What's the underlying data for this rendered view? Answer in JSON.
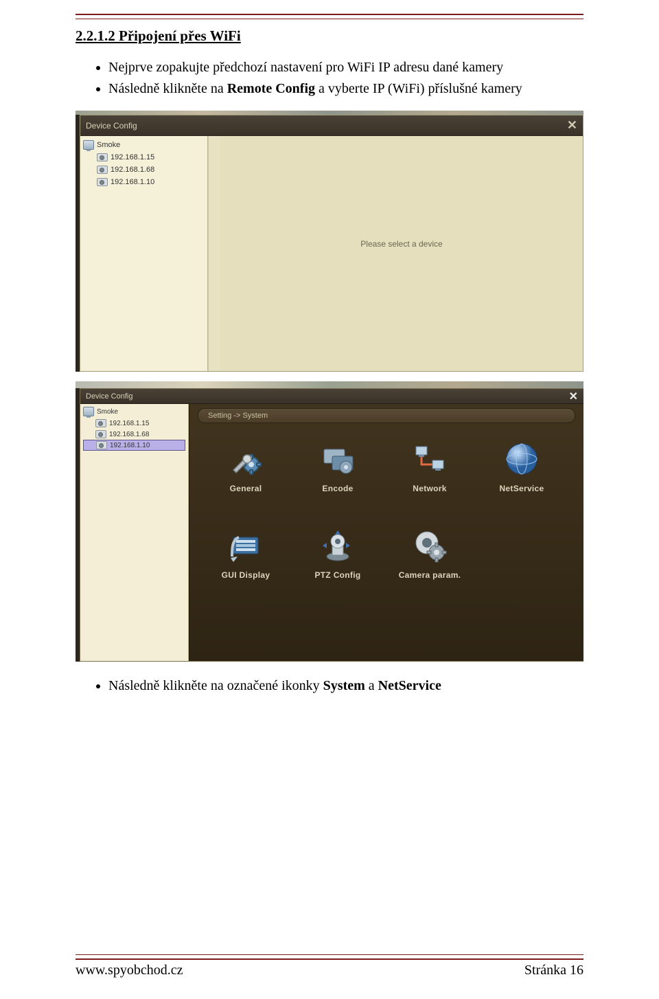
{
  "doc": {
    "section_title": "2.2.1.2 Připojení přes WiFi",
    "bullets_top_1": "Nejprve zopakujte předchozí nastavení pro WiFi IP adresu dané kamery",
    "bullets_top_2_a": "Následně klikněte na ",
    "bullets_top_2_b": "Remote Config",
    "bullets_top_2_c": " a vyberte IP (WiFi) příslušné kamery",
    "bullets_bottom_a": "Následně klikněte na označené ikonky ",
    "bullets_bottom_b": "System",
    "bullets_bottom_c": " a ",
    "bullets_bottom_d": "NetService"
  },
  "shot1": {
    "title": "Device Config",
    "placeholder": "Please select a device",
    "tree": {
      "root": "Smoke",
      "items": [
        "192.168.1.15",
        "192.168.1.68",
        "192.168.1.10"
      ]
    }
  },
  "shot2": {
    "title": "Device Config",
    "breadcrumb": "Setting -> System",
    "tree": {
      "root": "Smoke",
      "items": [
        "192.168.1.15",
        "192.168.1.68",
        "192.168.1.10"
      ],
      "selected_index": 2
    },
    "grid": {
      "r1": [
        "General",
        "Encode",
        "Network",
        "NetService"
      ],
      "r2": [
        "GUI Display",
        "PTZ Config",
        "Camera param."
      ]
    }
  },
  "footer": {
    "left": "www.spyobchod.cz",
    "right": "Stránka 16"
  }
}
